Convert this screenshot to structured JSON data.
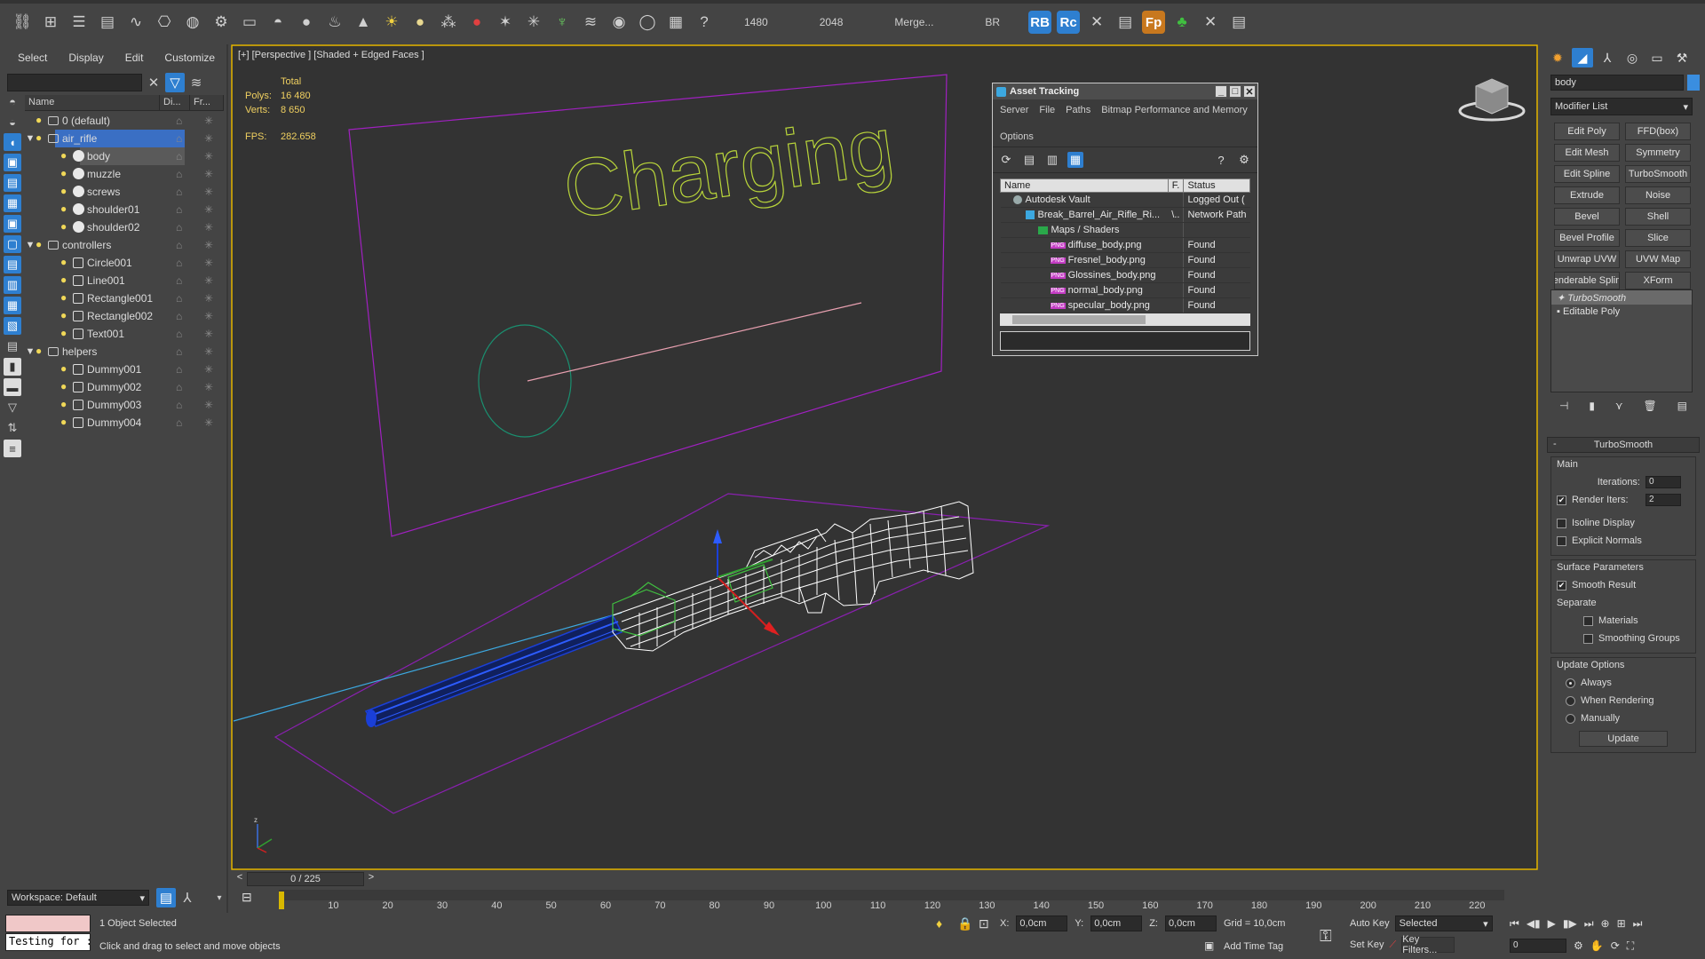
{
  "toolbar": {
    "icons": [
      "unlink-icon",
      "bind-icon",
      "layer-manager-icon",
      "scene-explorer-icon",
      "curve-editor-icon",
      "schematic-icon",
      "material-editor-icon",
      "render-setup-icon",
      "rendered-frame-icon",
      "box-icon",
      "sphere-icon",
      "geosphere-icon",
      "teapot-icon",
      "cone-icon",
      "sun-icon",
      "omni-light-icon",
      "particle-icon",
      "bomb-icon",
      "scatter-icon",
      "grass-icon",
      "hair-icon",
      "fur-icon",
      "render-icon",
      "asset-tracking-icon",
      "xref-icon",
      "help-icon"
    ],
    "value1": "1480",
    "value2": "2048",
    "merge_label": "Merge...",
    "br_label": "BR",
    "rb_label": "RB",
    "rc_label": "Rc",
    "fp_label": "Fp"
  },
  "explorer": {
    "menu": [
      "Select",
      "Display",
      "Edit",
      "Customize"
    ],
    "columns": [
      "Name",
      "Di...",
      "Fr..."
    ],
    "rows": [
      {
        "label": "0 (default)",
        "level": 0,
        "kind": "layer",
        "expand": ""
      },
      {
        "label": "air_rifle",
        "level": 0,
        "kind": "layer",
        "expand": "▼",
        "state": "selected"
      },
      {
        "label": "body",
        "level": 1,
        "kind": "object",
        "state": "highlight"
      },
      {
        "label": "muzzle",
        "level": 1,
        "kind": "object"
      },
      {
        "label": "screws",
        "level": 1,
        "kind": "object"
      },
      {
        "label": "shoulder01",
        "level": 1,
        "kind": "object"
      },
      {
        "label": "shoulder02",
        "level": 1,
        "kind": "object"
      },
      {
        "label": "controllers",
        "level": 0,
        "kind": "layer",
        "expand": "▼"
      },
      {
        "label": "Circle001",
        "level": 1,
        "kind": "shape"
      },
      {
        "label": "Line001",
        "level": 1,
        "kind": "shape"
      },
      {
        "label": "Rectangle001",
        "level": 1,
        "kind": "shape"
      },
      {
        "label": "Rectangle002",
        "level": 1,
        "kind": "shape"
      },
      {
        "label": "Text001",
        "level": 1,
        "kind": "shape"
      },
      {
        "label": "helpers",
        "level": 0,
        "kind": "layer",
        "expand": "▼"
      },
      {
        "label": "Dummy001",
        "level": 1,
        "kind": "helper"
      },
      {
        "label": "Dummy002",
        "level": 1,
        "kind": "helper"
      },
      {
        "label": "Dummy003",
        "level": 1,
        "kind": "helper"
      },
      {
        "label": "Dummy004",
        "level": 1,
        "kind": "helper"
      }
    ],
    "workspace": "Workspace: Default"
  },
  "viewport": {
    "label": "[+] [Perspective ] [Shaded + Edged Faces ]",
    "stats": {
      "total_label": "Total",
      "polys_label": "Polys:",
      "polys": "16 480",
      "verts_label": "Verts:",
      "verts": "8 650",
      "fps_label": "FPS:",
      "fps": "282.658"
    },
    "text_object": "Charging",
    "colors": {
      "wire": "#ffffff",
      "barrel": "#1a3fd8",
      "sign": "#a020c0",
      "text": "#b8d43a",
      "circle": "#1a9070",
      "line": "#e8a0b0"
    }
  },
  "asset": {
    "title": "Asset Tracking",
    "menu": [
      "Server",
      "File",
      "Paths",
      "Bitmap Performance and Memory",
      "Options"
    ],
    "columns": [
      "Name",
      "F.",
      "Status"
    ],
    "rows": [
      {
        "name": "Autodesk Vault",
        "f": "",
        "status": "Logged Out (",
        "indent": 1,
        "icon": "vault"
      },
      {
        "name": "Break_Barrel_Air_Rifle_Ri...",
        "f": "\\..",
        "status": "Network Path",
        "indent": 2,
        "icon": "file"
      },
      {
        "name": "Maps / Shaders",
        "f": "",
        "status": "",
        "indent": 3,
        "icon": "folder"
      },
      {
        "name": "diffuse_body.png",
        "f": "",
        "status": "Found",
        "indent": 4,
        "icon": "png"
      },
      {
        "name": "Fresnel_body.png",
        "f": "",
        "status": "Found",
        "indent": 4,
        "icon": "png"
      },
      {
        "name": "Glossines_body.png",
        "f": "",
        "status": "Found",
        "indent": 4,
        "icon": "png"
      },
      {
        "name": "normal_body.png",
        "f": "",
        "status": "Found",
        "indent": 4,
        "icon": "png"
      },
      {
        "name": "specular_body.png",
        "f": "",
        "status": "Found",
        "indent": 4,
        "icon": "png"
      }
    ]
  },
  "command": {
    "object_name": "body",
    "modifier_list": "Modifier List",
    "modifiers": [
      "Edit Poly",
      "FFD(box)",
      "Edit Mesh",
      "Symmetry",
      "Edit Spline",
      "TurboSmooth",
      "Extrude",
      "Noise",
      "Bevel",
      "Shell",
      "Bevel Profile",
      "Slice",
      "Unwrap UVW",
      "UVW Map",
      "enderable Splin",
      "XForm"
    ],
    "stack": [
      "TurboSmooth",
      "Editable Poly"
    ],
    "turbosmooth": {
      "title": "TurboSmooth",
      "main": "Main",
      "iterations_label": "Iterations:",
      "iterations": "0",
      "render_iters_label": "Render Iters:",
      "render_iters": "2",
      "isoline": "Isoline Display",
      "explicit": "Explicit Normals",
      "surface": "Surface Parameters",
      "smooth": "Smooth Result",
      "separate": "Separate",
      "materials": "Materials",
      "smoothing": "Smoothing Groups",
      "update_options": "Update Options",
      "always": "Always",
      "when_rendering": "When Rendering",
      "manually": "Manually",
      "update": "Update"
    }
  },
  "timeline": {
    "slider": "0 / 225",
    "ticks": [
      "10",
      "20",
      "30",
      "40",
      "50",
      "60",
      "70",
      "80",
      "90",
      "100",
      "110",
      "120",
      "130",
      "140",
      "150",
      "160",
      "170",
      "180",
      "190",
      "200",
      "210",
      "220"
    ]
  },
  "statusbar": {
    "maxscript": "Testing for :",
    "selected": "1 Object Selected",
    "prompt": "Click and drag to select and move objects",
    "x_label": "X:",
    "x": "0,0cm",
    "y_label": "Y:",
    "y": "0,0cm",
    "z_label": "Z:",
    "z": "0,0cm",
    "grid": "Grid = 10,0cm",
    "add_time_tag": "Add Time Tag",
    "auto_key": "Auto Key",
    "selected_dd": "Selected",
    "set_key": "Set Key",
    "key_filters": "Key Filters...",
    "frame": "0"
  }
}
